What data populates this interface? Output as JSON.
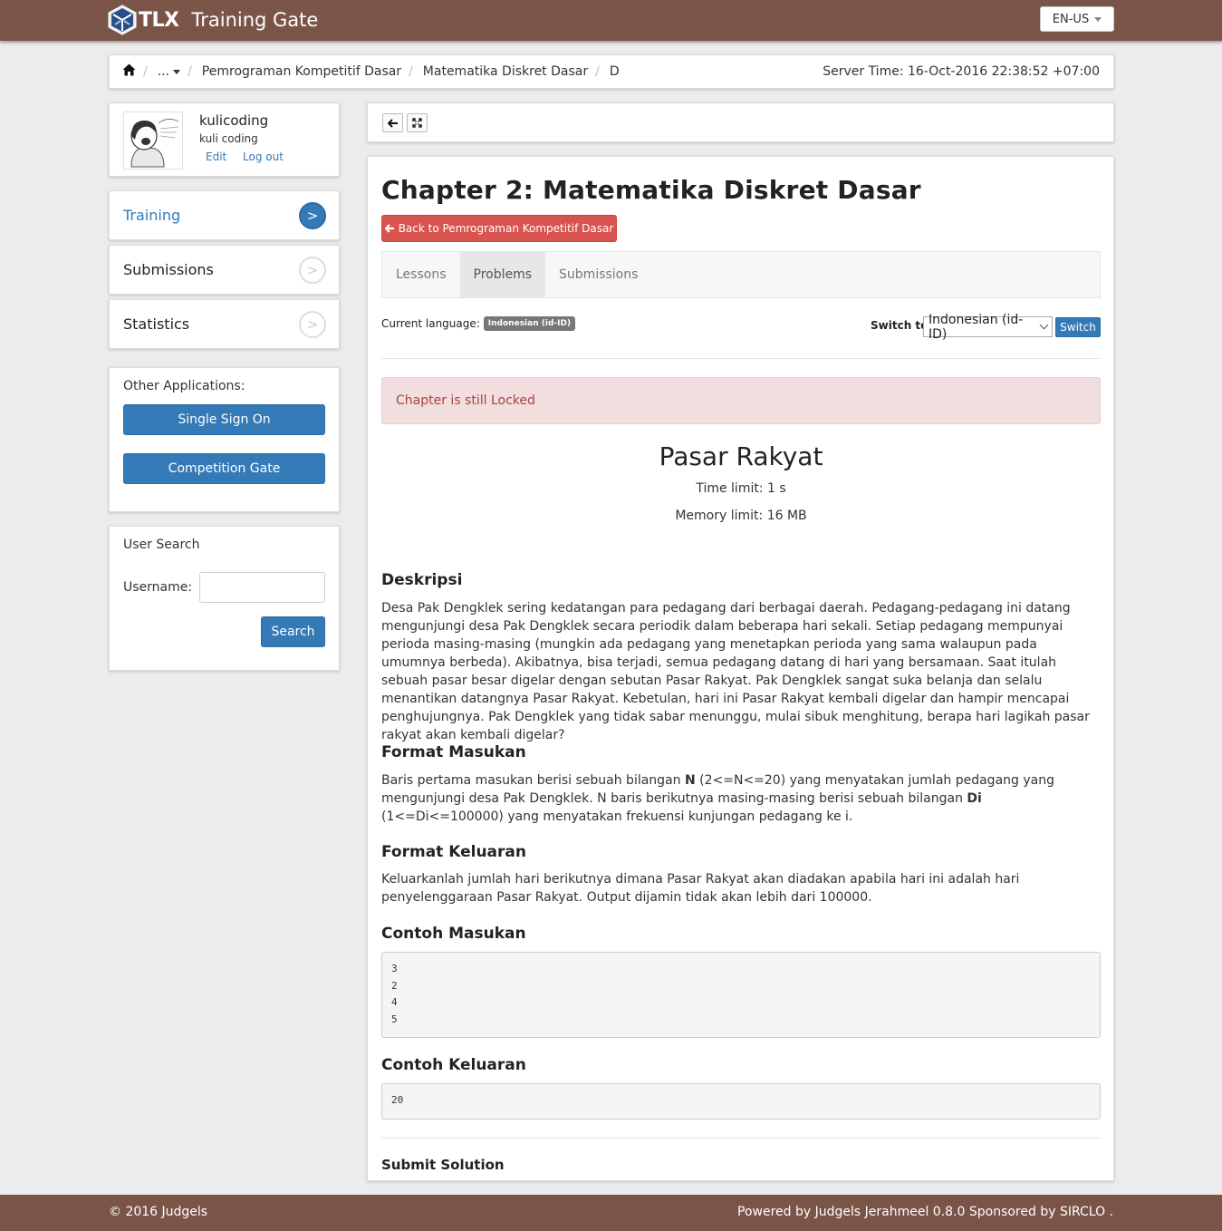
{
  "header": {
    "logo_text": "TLX",
    "app_title": "Training Gate",
    "language": "EN-US"
  },
  "breadcrumb": {
    "items": [
      "...",
      "Pemrograman Kompetitif Dasar",
      "Matematika Diskret Dasar",
      "D"
    ],
    "server_time": "Server Time: 16-Oct-2016 22:38:52 +07:00"
  },
  "profile": {
    "username": "kulicoding",
    "full_name": "kuli coding",
    "edit_label": "Edit",
    "logout_label": "Log out"
  },
  "sidebar": {
    "items": [
      {
        "label": "Training",
        "arrow": ">"
      },
      {
        "label": "Submissions",
        "arrow": ">"
      },
      {
        "label": "Statistics",
        "arrow": ">"
      }
    ],
    "other_apps_label": "Other Applications:",
    "apps": [
      "Single Sign On",
      "Competition Gate"
    ],
    "user_search": {
      "title": "User Search",
      "username_label": "Username:",
      "username_value": "",
      "search_label": "Search"
    }
  },
  "main": {
    "chapter_title": "Chapter 2: Matematika Diskret Dasar",
    "back_label": "Back to Pemrograman Kompetitif Dasar",
    "tabs": [
      "Lessons",
      "Problems",
      "Submissions"
    ],
    "active_tab": "Problems",
    "current_language_label": "Current language:",
    "current_language": "Indonesian (id-ID)",
    "switch_label": "Switch to",
    "switch_value": "Indonesian (id-ID)",
    "switch_button": "Switch",
    "alert": "Chapter is still Locked",
    "problem": {
      "title": "Pasar Rakyat",
      "time_limit": "Time limit: 1 s",
      "memory_limit": "Memory limit: 16 MB",
      "description_heading": "Deskripsi",
      "description": "Desa Pak Dengklek sering kedatangan para pedagang dari berbagai daerah. Pedagang-pedagang ini datang mengunjungi desa Pak Dengklek secara periodik dalam beberapa hari sekali. Setiap pedagang mempunyai perioda masing-masing (mungkin ada pedagang yang menetapkan perioda yang sama walaupun pada umumnya berbeda). Akibatnya, bisa terjadi, semua pedagang datang di hari yang bersamaan. Saat itulah sebuah pasar besar digelar dengan sebutan Pasar Rakyat. Pak Dengklek sangat suka belanja dan selalu menantikan datangnya Pasar Rakyat. Kebetulan, hari ini Pasar Rakyat kembali digelar dan hampir mencapai penghujungnya. Pak Dengklek yang tidak sabar menunggu, mulai sibuk menghitung, berapa hari lagikah pasar rakyat akan kembali digelar?",
      "input_heading": "Format Masukan",
      "input_p1": "Baris pertama masukan berisi sebuah bilangan ",
      "input_b1": "N",
      "input_p2": " (2<=N<=20) yang menyatakan jumlah pedagang yang mengunjungi desa Pak Dengklek. N baris berikutnya masing-masing berisi sebuah bilangan ",
      "input_b2": "Di",
      "input_p3": " (1<=Di<=100000) yang menyatakan frekuensi kunjungan pedagang ke i.",
      "output_heading": "Format Keluaran",
      "output": "Keluarkanlah jumlah hari berikutnya dimana Pasar Rakyat akan diadakan apabila hari ini adalah hari penyelenggaraan Pasar Rakyat. Output dijamin tidak akan lebih dari 100000.",
      "sample_input_heading": "Contoh Masukan",
      "sample_input": "3\n2\n4\n5",
      "sample_output_heading": "Contoh Keluaran",
      "sample_output": "20",
      "submit_heading": "Submit Solution"
    }
  },
  "footer": {
    "copyright": "© 2016 Judgels",
    "powered": "Powered by Judgels Jerahmeel 0.8.0 Sponsored by SIRCLO ."
  },
  "colors": {
    "brand": "#7a5547",
    "primary": "#337ab7",
    "danger": "#d9534f",
    "alert_bg": "#f2dede"
  },
  "icons": [
    "home-icon",
    "chevron-down-icon",
    "arrow-left-icon",
    "fullscreen-icon",
    "chevron-right-icon"
  ]
}
